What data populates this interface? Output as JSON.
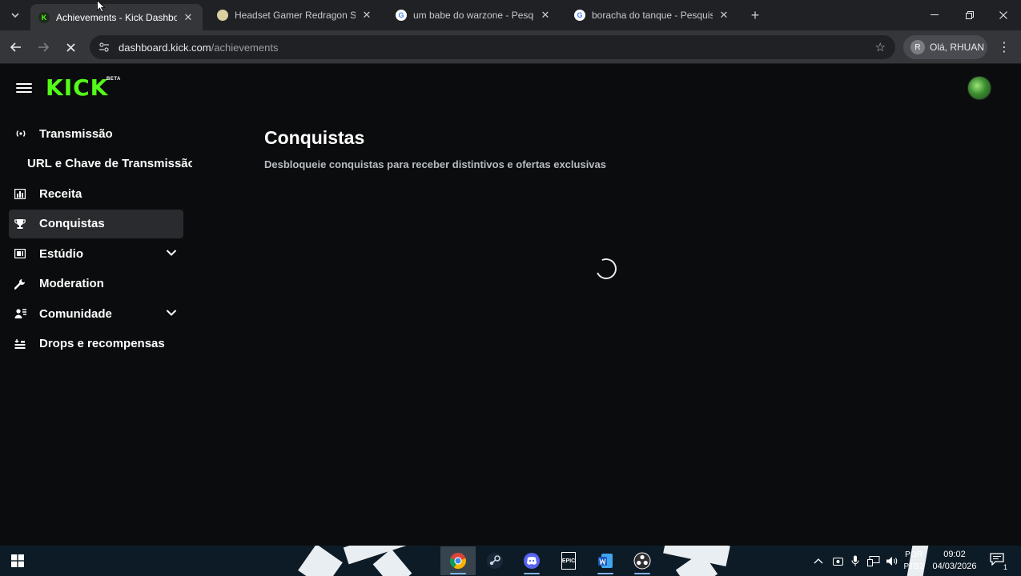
{
  "browser": {
    "tabs": [
      {
        "title": "Achievements - Kick Dashboard",
        "active": true,
        "favicon": "kick-icon"
      },
      {
        "title": "Headset Gamer Redragon Scylla",
        "active": false,
        "favicon": "headset-site-icon"
      },
      {
        "title": "um babe do warzone - Pesquisa",
        "active": false,
        "favicon": "google-icon"
      },
      {
        "title": "boracha do tanque - Pesquisa G",
        "active": false,
        "favicon": "google-icon"
      }
    ],
    "url_host": "dashboard.kick.com",
    "url_path": "/achievements",
    "profile_initial": "R",
    "profile_label": "Olá, RHUAN"
  },
  "app": {
    "logo_text": "KICK",
    "logo_badge": "BETA"
  },
  "sidebar": {
    "items": [
      {
        "label": "Transmissão",
        "icon": "broadcast-icon"
      },
      {
        "label": "URL e Chave de Transmissão",
        "icon": ""
      },
      {
        "label": "Receita",
        "icon": "chart-icon"
      },
      {
        "label": "Conquistas",
        "icon": "trophy-icon",
        "active": true
      },
      {
        "label": "Estúdio",
        "icon": "studio-icon",
        "expandable": true
      },
      {
        "label": "Moderation",
        "icon": "wrench-icon"
      },
      {
        "label": "Comunidade",
        "icon": "people-icon",
        "expandable": true
      },
      {
        "label": "Drops e recompensas",
        "icon": "drops-icon"
      }
    ]
  },
  "main": {
    "title": "Conquistas",
    "subtitle": "Desbloqueie conquistas para receber distintivos e ofertas exclusivas"
  },
  "taskbar": {
    "language_line1": "POR",
    "language_line2": "PTB2",
    "time": "09:02",
    "date": "04/03/2026",
    "notification_count": "1",
    "epic_label": "EPIC"
  },
  "colors": {
    "accent": "#53fc18",
    "background": "#0b0c0d",
    "active_nav": "#2a2b2e"
  }
}
